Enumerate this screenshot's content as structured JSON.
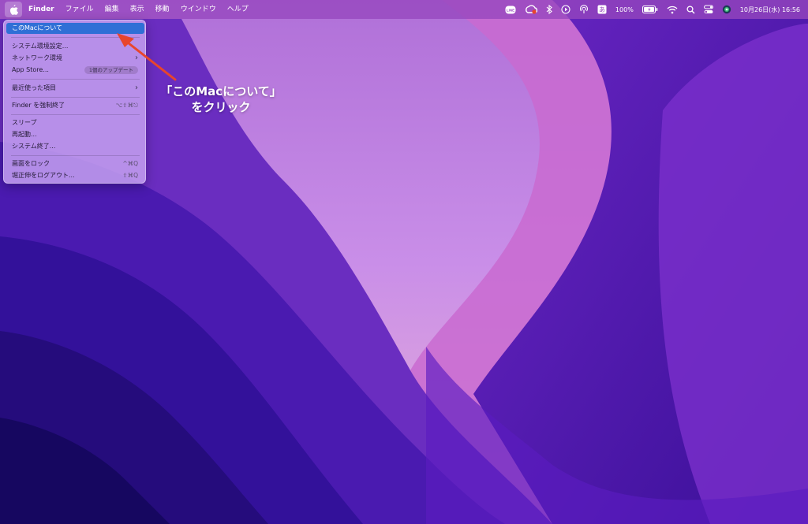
{
  "menubar": {
    "app_name": "Finder",
    "items": [
      "ファイル",
      "編集",
      "表示",
      "移動",
      "ウインドウ",
      "ヘルプ"
    ],
    "status": {
      "line_icon_label": "LINE",
      "battery_percent": "100%",
      "ime_label": "あ",
      "datetime": "10月26日(水)  16:56"
    }
  },
  "apple_menu": {
    "items": [
      {
        "label": "このMacについて"
      },
      {
        "label": "システム環境設定..."
      },
      {
        "label": "ネットワーク環境"
      },
      {
        "label": "App Store...",
        "badge": "1個のアップデート"
      },
      {
        "label": "最近使った項目"
      },
      {
        "label": "Finder を強制終了",
        "shortcut": "⌥⇧⌘⎋"
      },
      {
        "label": "スリープ"
      },
      {
        "label": "再起動..."
      },
      {
        "label": "システム終了..."
      },
      {
        "label": "画面をロック",
        "shortcut": "^⌘Q"
      },
      {
        "label": "堀正伸をログアウト...",
        "shortcut": "⇧⌘Q"
      }
    ]
  },
  "annotation": {
    "line1": "「このMacについて」",
    "line2": "をクリック",
    "arrow_color": "#e8452c"
  },
  "colors": {
    "menubar": "#9646be",
    "highlight": "#2f6fd6",
    "wallpaper_dark": "#1a0c5c",
    "wallpaper_light": "#e0a8f0"
  }
}
